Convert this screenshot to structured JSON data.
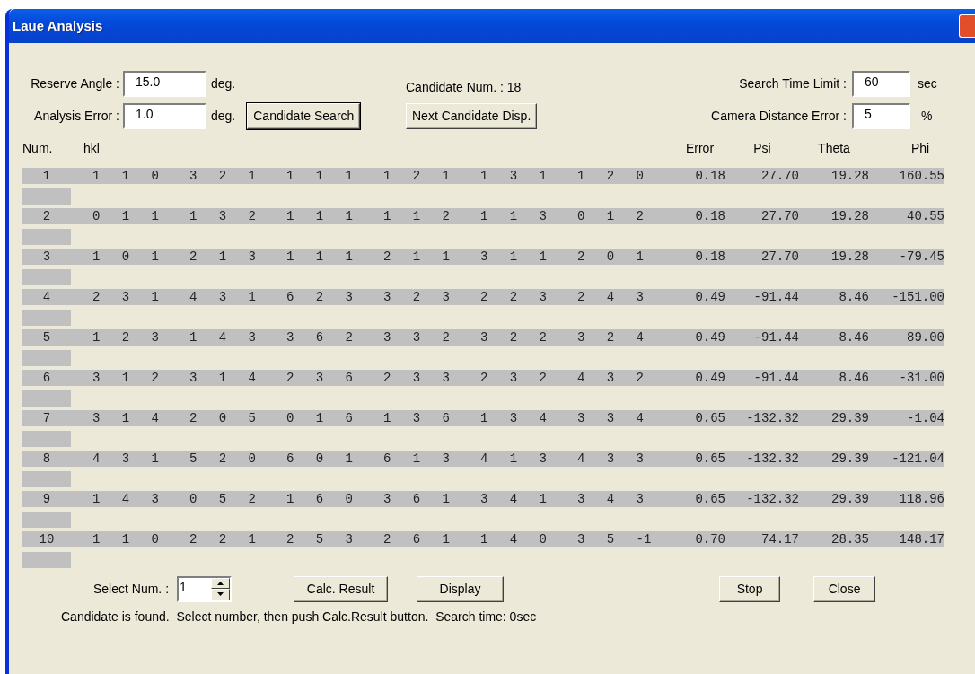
{
  "window": {
    "title": "Laue Analysis"
  },
  "left_fields": [
    {
      "label": "Reserve Angle :",
      "value": "15.0",
      "unit": "deg."
    },
    {
      "label": "Analysis Error :",
      "value": "1.0",
      "unit": "deg."
    }
  ],
  "candidate_search_button": "Candidate Search",
  "candidate_count": "Candidate Num. : 18",
  "next_candidate_button": "Next Candidate Disp.",
  "right_fields": [
    {
      "label": "Search Time Limit :",
      "value": "60",
      "unit": "sec"
    },
    {
      "label": "Camera Distance Error :",
      "value": "5",
      "unit": "%"
    }
  ],
  "table": {
    "columns": [
      "Num.",
      "hkl",
      "Error",
      "Psi",
      "Theta",
      "Phi"
    ],
    "rows": [
      {
        "num": "1",
        "hkl": [
          "1 1 0",
          "3 2 1",
          "1 1 1",
          "1 2 1",
          "1 3 1",
          "1 2 0"
        ],
        "error": "0.18",
        "psi": "27.70",
        "theta": "19.28",
        "phi": "160.55"
      },
      {
        "num": "2",
        "hkl": [
          "0 1 1",
          "1 3 2",
          "1 1 1",
          "1 1 2",
          "1 1 3",
          "0 1 2"
        ],
        "error": "0.18",
        "psi": "27.70",
        "theta": "19.28",
        "phi": "40.55"
      },
      {
        "num": "3",
        "hkl": [
          "1 0 1",
          "2 1 3",
          "1 1 1",
          "2 1 1",
          "3 1 1",
          "2 0 1"
        ],
        "error": "0.18",
        "psi": "27.70",
        "theta": "19.28",
        "phi": "-79.45"
      },
      {
        "num": "4",
        "hkl": [
          "2 3 1",
          "4 3 1",
          "6 2 3",
          "3 2 3",
          "2 2 3",
          "2 4 3"
        ],
        "error": "0.49",
        "psi": "-91.44",
        "theta": "8.46",
        "phi": "-151.00"
      },
      {
        "num": "5",
        "hkl": [
          "1 2 3",
          "1 4 3",
          "3 6 2",
          "3 3 2",
          "3 2 2",
          "3 2 4"
        ],
        "error": "0.49",
        "psi": "-91.44",
        "theta": "8.46",
        "phi": "89.00"
      },
      {
        "num": "6",
        "hkl": [
          "3 1 2",
          "3 1 4",
          "2 3 6",
          "2 3 3",
          "2 3 2",
          "4 3 2"
        ],
        "error": "0.49",
        "psi": "-91.44",
        "theta": "8.46",
        "phi": "-31.00"
      },
      {
        "num": "7",
        "hkl": [
          "3 1 4",
          "2 0 5",
          "0 1 6",
          "1 3 6",
          "1 3 4",
          "3 3 4"
        ],
        "error": "0.65",
        "psi": "-132.32",
        "theta": "29.39",
        "phi": "-1.04"
      },
      {
        "num": "8",
        "hkl": [
          "4 3 1",
          "5 2 0",
          "6 0 1",
          "6 1 3",
          "4 1 3",
          "4 3 3"
        ],
        "error": "0.65",
        "psi": "-132.32",
        "theta": "29.39",
        "phi": "-121.04"
      },
      {
        "num": "9",
        "hkl": [
          "1 4 3",
          "0 5 2",
          "1 6 0",
          "3 6 1",
          "3 4 1",
          "3 4 3"
        ],
        "error": "0.65",
        "psi": "-132.32",
        "theta": "29.39",
        "phi": "118.96"
      },
      {
        "num": "10",
        "hkl": [
          "1 1 0",
          "2 2 1",
          "2 5 3",
          "2 6 1",
          "1 4 0",
          "3 5 -1"
        ],
        "error": "0.70",
        "psi": "74.17",
        "theta": "28.35",
        "phi": "148.17"
      }
    ]
  },
  "select": {
    "label": "Select Num. :",
    "value": "1"
  },
  "buttons": [
    "Calc. Result",
    "Display",
    "Stop",
    "Close"
  ],
  "status": "Candidate is found.  Select number, then push Calc.Result button.  Search time: 0sec"
}
